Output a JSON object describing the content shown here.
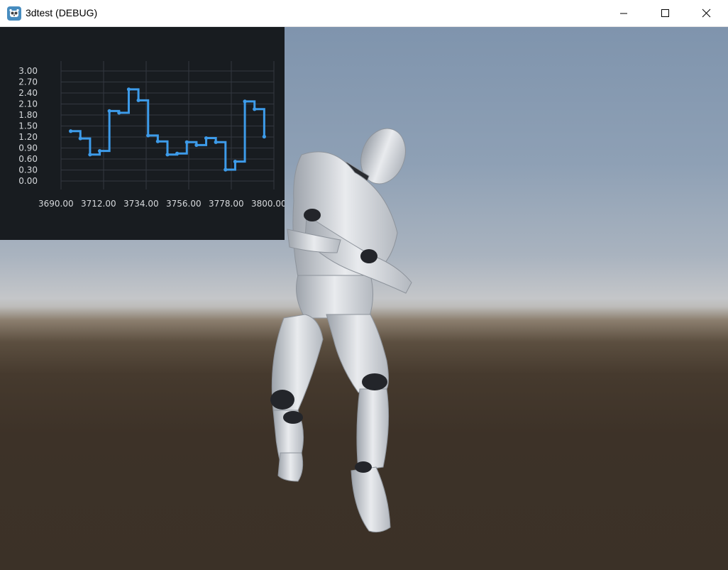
{
  "window": {
    "title": "3dtest (DEBUG)",
    "app_icon": "godot-engine-icon",
    "controls": {
      "minimize": "minimize-icon",
      "maximize": "maximize-icon",
      "close": "close-icon"
    }
  },
  "colors": {
    "chart_background": "#181c20",
    "series_line": "#3d9be9",
    "grid": "#333840",
    "tick_text": "#d6d9dc"
  },
  "chart_data": {
    "type": "line",
    "step": true,
    "title": "",
    "xlabel": "",
    "ylabel": "",
    "xlim": [
      3690,
      3800
    ],
    "ylim": [
      0,
      3
    ],
    "x_ticks": [
      "3690.00",
      "3712.00",
      "3734.00",
      "3756.00",
      "3778.00",
      "3800.00"
    ],
    "y_ticks": [
      "3.00",
      "2.70",
      "2.40",
      "2.10",
      "1.80",
      "1.50",
      "1.20",
      "0.90",
      "0.60",
      "0.30",
      "0.00"
    ],
    "grid": true,
    "series": [
      {
        "x": [
          3695,
          3700,
          3705,
          3710,
          3715,
          3720,
          3725,
          3730,
          3735,
          3740,
          3745,
          3750,
          3755,
          3760,
          3765,
          3770,
          3775,
          3780,
          3785,
          3790,
          3795
        ],
        "y": [
          1.36,
          1.16,
          0.72,
          0.82,
          1.91,
          1.86,
          2.5,
          2.2,
          1.24,
          1.08,
          0.72,
          0.75,
          1.06,
          0.98,
          1.17,
          1.06,
          0.31,
          0.53,
          2.17,
          1.96,
          1.21
        ]
      }
    ]
  }
}
